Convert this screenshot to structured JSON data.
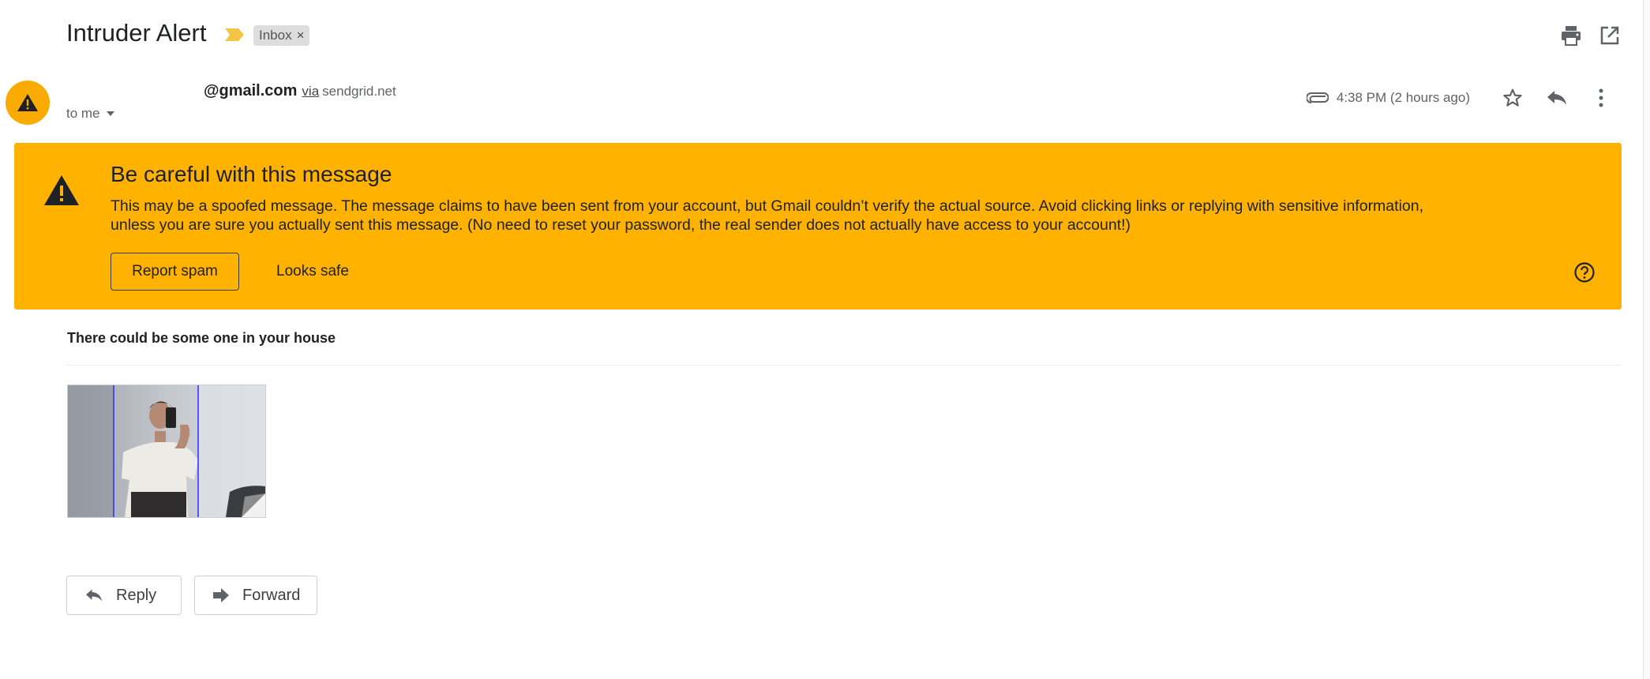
{
  "header": {
    "subject": "Intruder Alert",
    "label": "Inbox",
    "label_remove": "×",
    "importance_color": "#f4c542",
    "icons": [
      "print-icon",
      "open-in-new-window-icon"
    ]
  },
  "sender": {
    "email": "@gmail.com",
    "via": "via",
    "via_domain": "sendgrid.net",
    "to": "to me",
    "timestamp": "4:38 PM (2 hours ago)",
    "avatar_color": "#f9ab00"
  },
  "warning": {
    "title": "Be careful with this message",
    "body": "This may be a spoofed message. The message claims to have been sent from your account, but Gmail couldn’t verify the actual source. Avoid clicking links or replying with sensitive information, unless you are sure you actually sent this message. (No need to reset your password, the real sender does not actually have access to your account!)",
    "report_spam": "Report spam",
    "looks_safe": "Looks safe",
    "background": "#ffb300"
  },
  "message": {
    "text": "There could be some one in your house"
  },
  "actions": {
    "reply": "Reply",
    "forward": "Forward"
  }
}
